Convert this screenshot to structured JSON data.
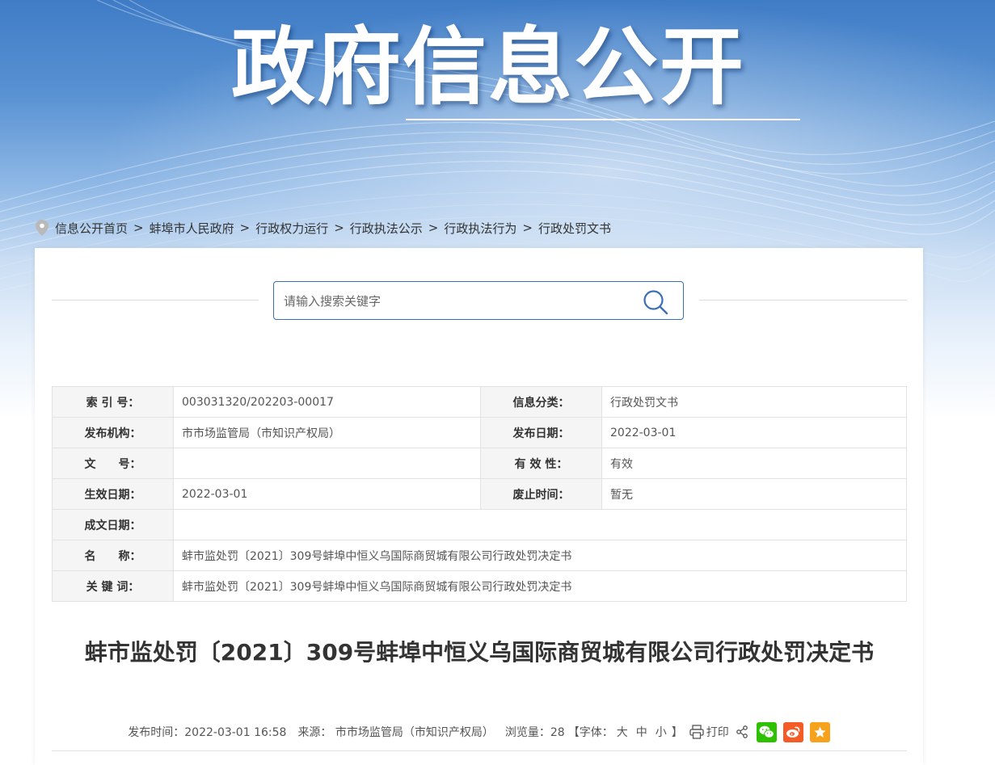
{
  "banner": {
    "title": "政府信息公开"
  },
  "breadcrumb": {
    "items": [
      "信息公开首页",
      "蚌埠市人民政府",
      "行政权力运行",
      "行政执法公示",
      "行政执法行为",
      "行政处罚文书"
    ],
    "separator": ">"
  },
  "search": {
    "placeholder": "请输入搜索关键字"
  },
  "meta": {
    "index_label": "索 引 号：",
    "index_value": "003031320/202203-00017",
    "category_label": "信息分类：",
    "category_value": "行政处罚文书",
    "org_label": "发布机构：",
    "org_value": "市市场监管局（市知识产权局）",
    "pubdate_label": "发布日期：",
    "pubdate_value": "2022-03-01",
    "docno_label": "文　　号：",
    "docno_value": "",
    "validity_label": "有 效 性：",
    "validity_value": "有效",
    "effective_label": "生效日期：",
    "effective_value": "2022-03-01",
    "repeal_label": "废止时间：",
    "repeal_value": "暂无",
    "written_label": "成文日期：",
    "written_value": "",
    "name_label": "名　　称：",
    "name_value": "蚌市监处罚〔2021〕309号蚌埠中恒义乌国际商贸城有限公司行政处罚决定书",
    "keywords_label": "关 键 词：",
    "keywords_value": "蚌市监处罚〔2021〕309号蚌埠中恒义乌国际商贸城有限公司行政处罚决定书"
  },
  "article": {
    "title": "蚌市监处罚〔2021〕309号蚌埠中恒义乌国际商贸城有限公司行政处罚决定书",
    "publish_time": "发布时间：2022-03-01 16:58",
    "source": "来源： 市市场监管局（市知识产权局）",
    "views": "浏览量：28",
    "font_open": "【字体：",
    "font_large": "大",
    "font_medium": "中",
    "font_small": "小",
    "font_close": "】",
    "print": "打印"
  },
  "icons": {
    "location": "location-pin-icon",
    "search": "magnifier-icon",
    "print": "printer-icon",
    "share": "share-icon",
    "wechat": "wechat-icon",
    "weibo": "weibo-icon",
    "favorite": "star-icon"
  },
  "colors": {
    "wechat": "#2dc100",
    "weibo": "#f45b26",
    "favorite": "#f7a21c",
    "accent": "#3a6fb8"
  }
}
